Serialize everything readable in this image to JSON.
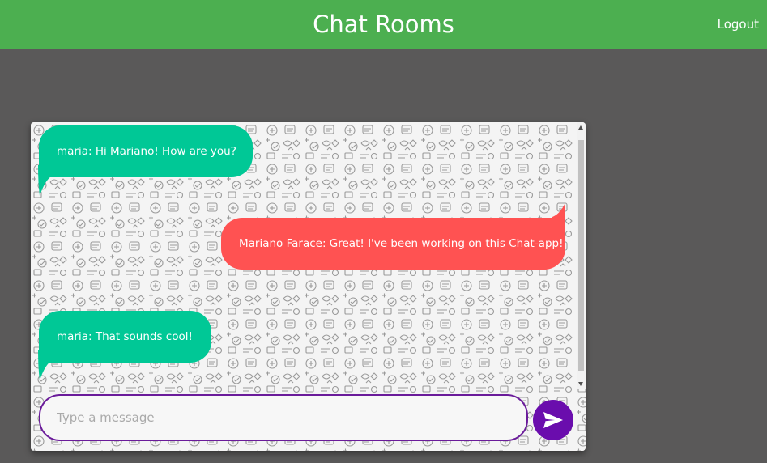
{
  "header": {
    "title": "Chat Rooms",
    "logout_label": "Logout"
  },
  "messages": [
    {
      "author": "maria",
      "text": "maria: Hi Mariano! How are you?",
      "side": "left"
    },
    {
      "author": "Mariano Farace",
      "text": "Mariano Farace: Great! I've been working on this Chat-app!",
      "side": "right"
    },
    {
      "author": "maria",
      "text": "maria: That sounds cool!",
      "side": "left"
    }
  ],
  "composer": {
    "placeholder": "Type a message",
    "value": ""
  },
  "icons": {
    "send": "send-icon"
  },
  "colors": {
    "header": "#4caf50",
    "page_background": "#5a5959",
    "incoming_bubble": "#00c896",
    "outgoing_bubble": "#ff5252",
    "accent": "#6a0dad"
  }
}
